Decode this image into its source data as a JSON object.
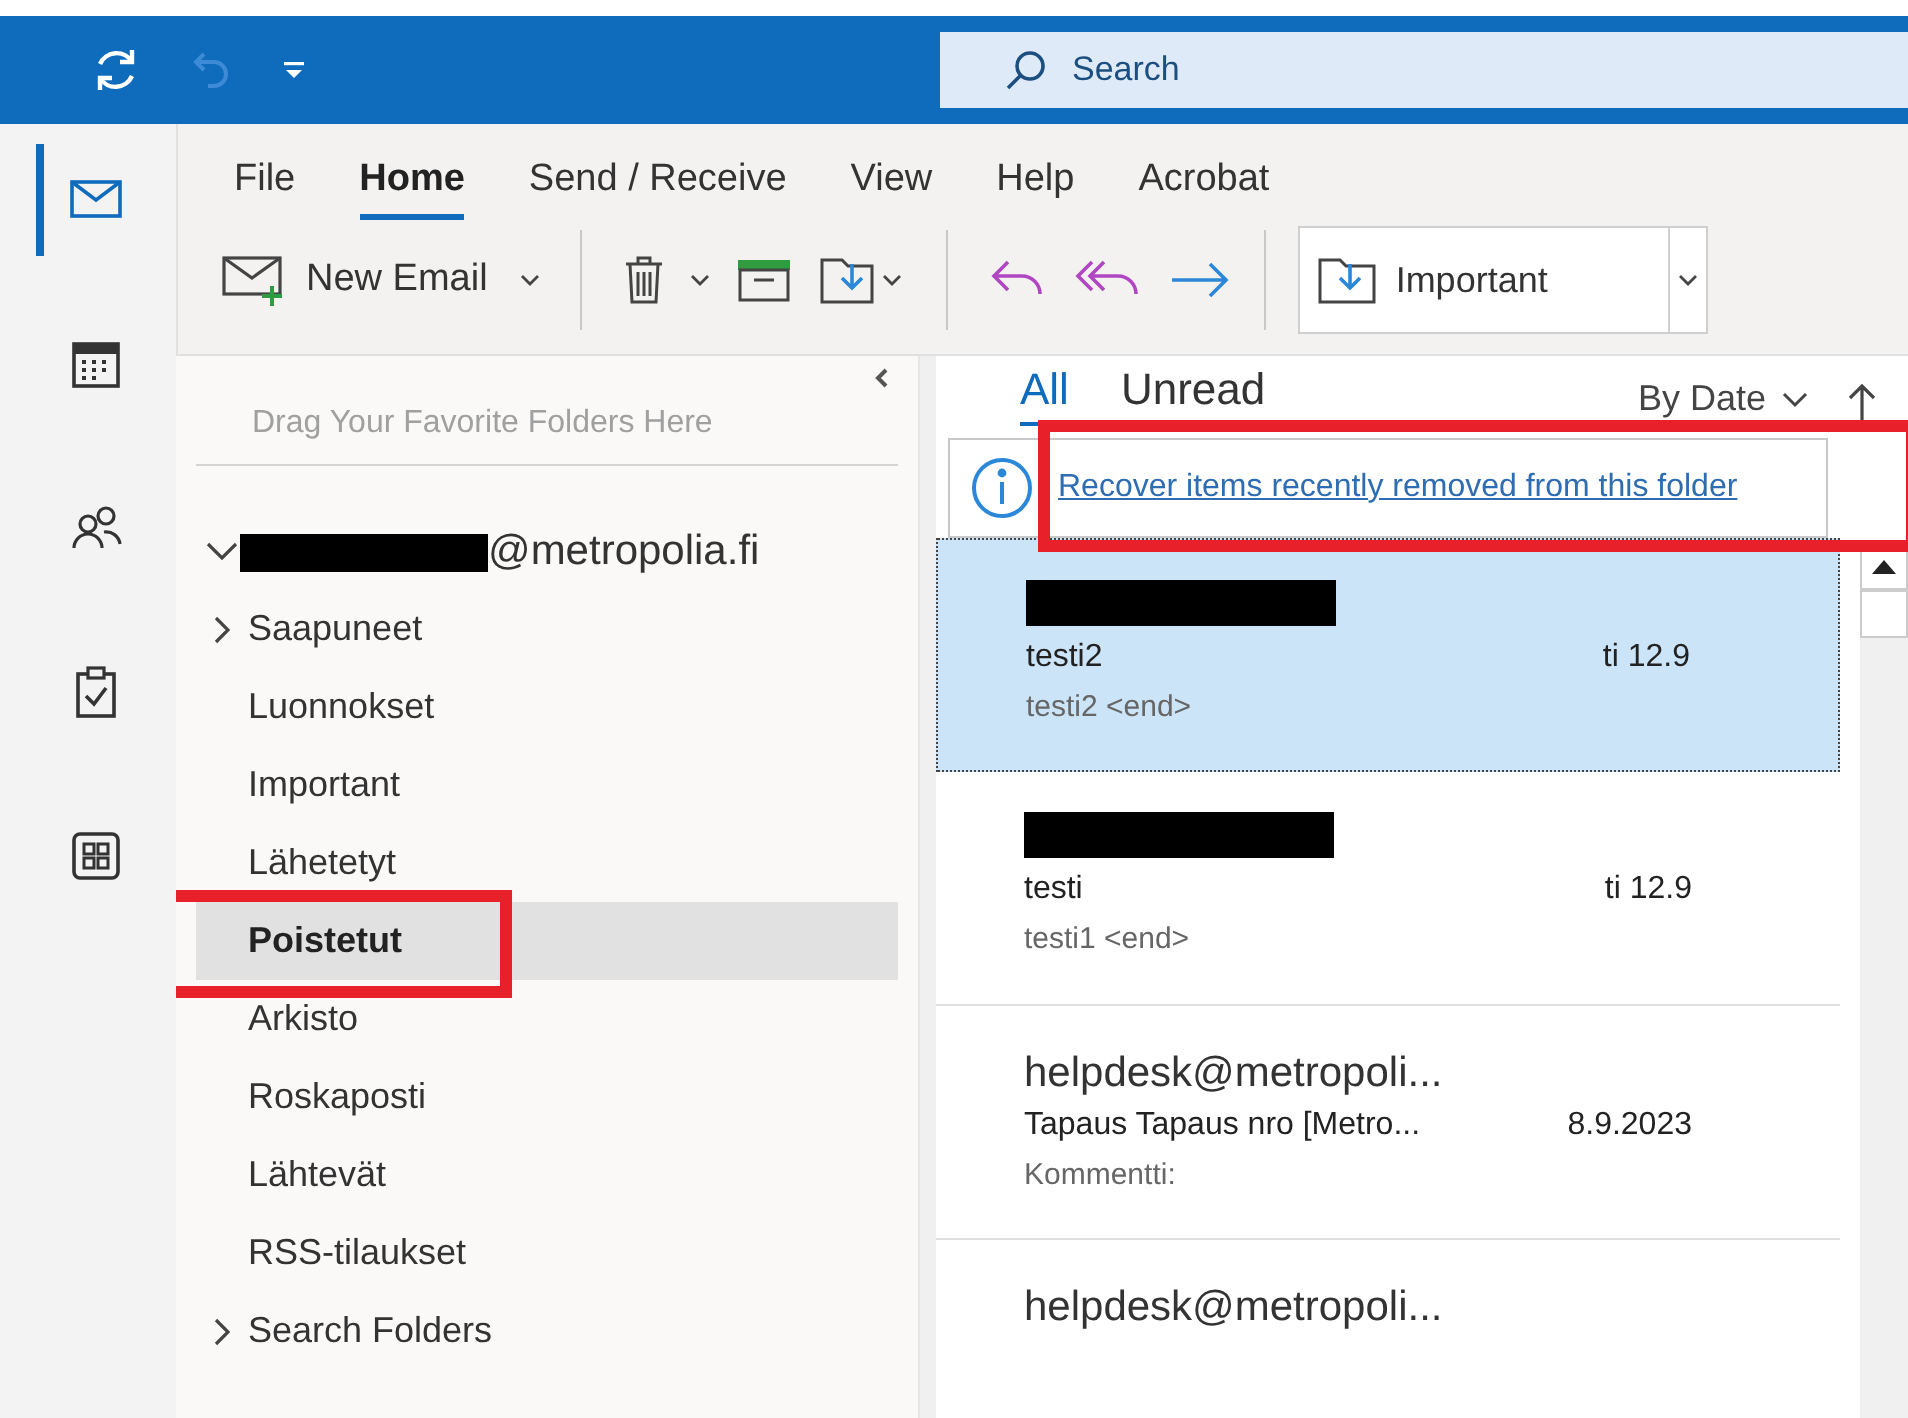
{
  "search": {
    "placeholder": "Search"
  },
  "nav": [
    {
      "kind": "mail",
      "selected": true
    },
    {
      "kind": "calendar",
      "selected": false
    },
    {
      "kind": "people",
      "selected": false
    },
    {
      "kind": "tasks",
      "selected": false
    },
    {
      "kind": "apps",
      "selected": false
    }
  ],
  "ribbon_tabs": [
    {
      "label": "File",
      "selected": false
    },
    {
      "label": "Home",
      "selected": true
    },
    {
      "label": "Send / Receive",
      "selected": false
    },
    {
      "label": "View",
      "selected": false
    },
    {
      "label": "Help",
      "selected": false
    },
    {
      "label": "Acrobat",
      "selected": false
    }
  ],
  "toolbar": {
    "new_email": "New Email",
    "quick_step": "Important"
  },
  "folder_pane": {
    "favorites_hint": "Drag Your Favorite Folders Here",
    "account": "@metropolia.fi",
    "folders": [
      {
        "label": "Saapuneet",
        "expandable": true,
        "selected": false,
        "highlighted": false
      },
      {
        "label": "Luonnokset",
        "expandable": false,
        "selected": false,
        "highlighted": false
      },
      {
        "label": "Important",
        "expandable": false,
        "selected": false,
        "highlighted": false
      },
      {
        "label": "Lähetetyt",
        "expandable": false,
        "selected": false,
        "highlighted": false
      },
      {
        "label": "Poistetut",
        "expandable": false,
        "selected": true,
        "highlighted": true
      },
      {
        "label": "Arkisto",
        "expandable": false,
        "selected": false,
        "highlighted": false
      },
      {
        "label": "Roskaposti",
        "expandable": false,
        "selected": false,
        "highlighted": false
      },
      {
        "label": "Lähtevät",
        "expandable": false,
        "selected": false,
        "highlighted": false
      },
      {
        "label": "RSS-tilaukset",
        "expandable": false,
        "selected": false,
        "highlighted": false
      },
      {
        "label": "Search Folders",
        "expandable": true,
        "selected": false,
        "highlighted": false
      }
    ]
  },
  "message_list": {
    "filters": [
      {
        "label": "All",
        "selected": true
      },
      {
        "label": "Unread",
        "selected": false
      }
    ],
    "sort": "By Date",
    "recover_link": {
      "text": "Recover items recently removed from this folder",
      "highlighted": true
    },
    "messages": [
      {
        "subject": "testi2",
        "date": "ti 12.9",
        "preview": "testi2 <end>",
        "selected": true
      },
      {
        "subject": "testi",
        "date": "ti 12.9",
        "preview": "testi1 <end>",
        "selected": false
      },
      {
        "sender": "helpdesk@metropoli...",
        "subject": "Tapaus Tapaus nro [Metro...",
        "date": "8.9.2023",
        "preview": "Kommentti:",
        "selected": false
      },
      {
        "sender": "helpdesk@metropoli...",
        "selected": false
      }
    ]
  }
}
